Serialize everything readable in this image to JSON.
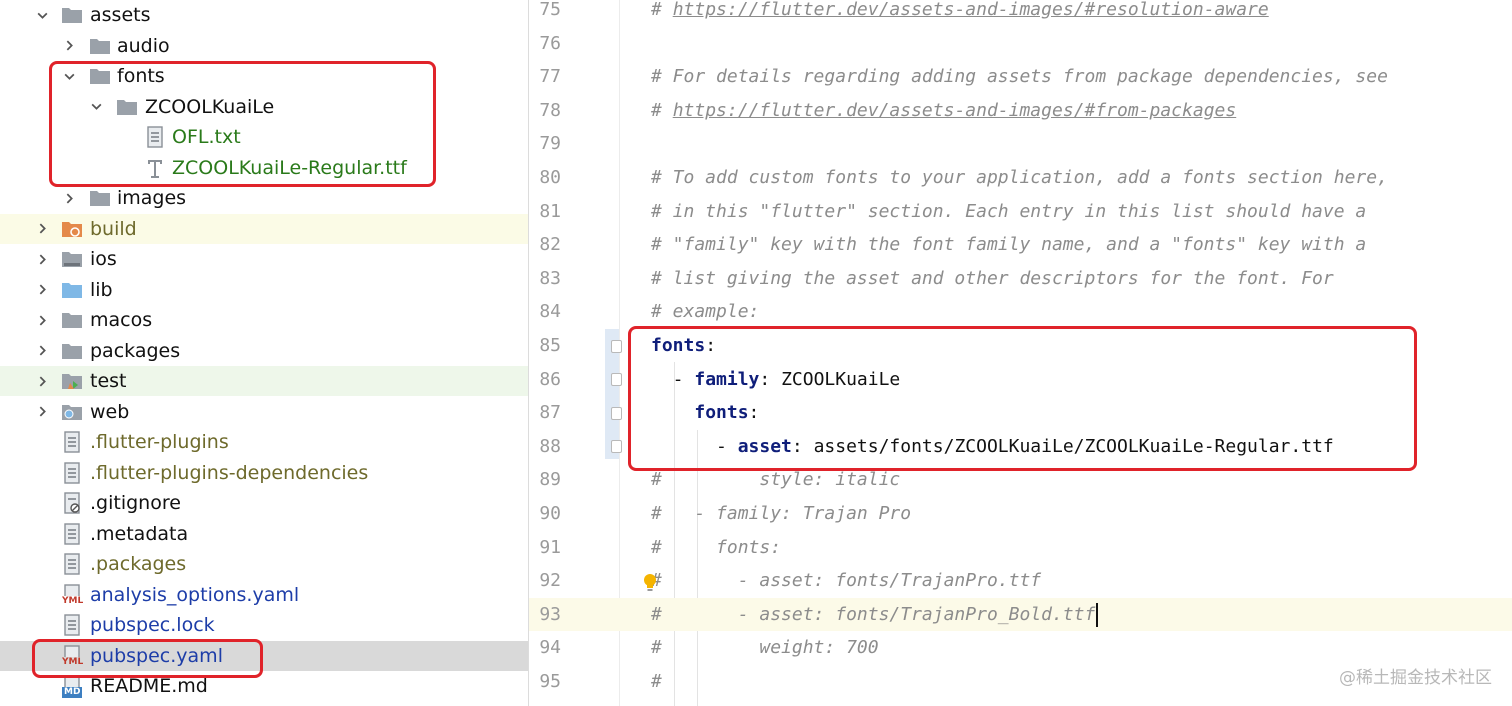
{
  "tree": {
    "rows": [
      {
        "label": "assets",
        "depth": 0,
        "expanded": true,
        "type": "folder"
      },
      {
        "label": "audio",
        "depth": 1,
        "expanded": false,
        "type": "folder"
      },
      {
        "label": "fonts",
        "depth": 1,
        "expanded": true,
        "type": "folder"
      },
      {
        "label": "ZCOOLKuaiLe",
        "depth": 2,
        "expanded": true,
        "type": "folder"
      },
      {
        "label": "OFL.txt",
        "depth": 3,
        "type": "text-file"
      },
      {
        "label": "ZCOOLKuaiLe-Regular.ttf",
        "depth": 3,
        "type": "font-file"
      },
      {
        "label": "images",
        "depth": 1,
        "expanded": false,
        "type": "folder"
      },
      {
        "label": "build",
        "depth": 0,
        "expanded": false,
        "type": "build-folder"
      },
      {
        "label": "ios",
        "depth": 0,
        "expanded": false,
        "type": "folder"
      },
      {
        "label": "lib",
        "depth": 0,
        "expanded": false,
        "type": "source-folder"
      },
      {
        "label": "macos",
        "depth": 0,
        "expanded": false,
        "type": "folder"
      },
      {
        "label": "packages",
        "depth": 0,
        "expanded": false,
        "type": "folder"
      },
      {
        "label": "test",
        "depth": 0,
        "expanded": false,
        "type": "test-folder"
      },
      {
        "label": "web",
        "depth": 0,
        "expanded": false,
        "type": "web-folder"
      },
      {
        "label": ".flutter-plugins",
        "depth": 0,
        "type": "file"
      },
      {
        "label": ".flutter-plugins-dependencies",
        "depth": 0,
        "type": "file"
      },
      {
        "label": ".gitignore",
        "depth": 0,
        "type": "ignore-file"
      },
      {
        "label": ".metadata",
        "depth": 0,
        "type": "file"
      },
      {
        "label": ".packages",
        "depth": 0,
        "type": "file"
      },
      {
        "label": "analysis_options.yaml",
        "depth": 0,
        "type": "yaml-file"
      },
      {
        "label": "pubspec.lock",
        "depth": 0,
        "type": "file"
      },
      {
        "label": "pubspec.yaml",
        "depth": 0,
        "type": "yaml-file",
        "selected": true
      },
      {
        "label": "README.md",
        "depth": 0,
        "type": "md-file"
      }
    ],
    "yaml_badge": "YML",
    "md_badge": "MD"
  },
  "editor": {
    "lines": [
      {
        "num": "75",
        "text": "# https://flutter.dev/assets-and-images/#resolution-aware"
      },
      {
        "num": "76",
        "text": ""
      },
      {
        "num": "77",
        "text": "# For details regarding adding assets from package dependencies, see"
      },
      {
        "num": "78",
        "text": "# https://flutter.dev/assets-and-images/#from-packages"
      },
      {
        "num": "79",
        "text": ""
      },
      {
        "num": "80",
        "text": "# To add custom fonts to your application, add a fonts section here,"
      },
      {
        "num": "81",
        "text": "# in this \"flutter\" section. Each entry in this list should have a"
      },
      {
        "num": "82",
        "text": "# \"family\" key with the font family name, and a \"fonts\" key with a"
      },
      {
        "num": "83",
        "text": "# list giving the asset and other descriptors for the font. For"
      },
      {
        "num": "84",
        "text": "# example:"
      },
      {
        "num": "85",
        "text": "fonts:"
      },
      {
        "num": "86",
        "text": "  - family: ZCOOLKuaiLe"
      },
      {
        "num": "87",
        "text": "    fonts:"
      },
      {
        "num": "88",
        "text": "      - asset: assets/fonts/ZCOOLKuaiLe/ZCOOLKuaiLe-Regular.ttf"
      },
      {
        "num": "89",
        "text": "#         style: italic"
      },
      {
        "num": "90",
        "text": "#   - family: Trajan Pro"
      },
      {
        "num": "91",
        "text": "#     fonts:"
      },
      {
        "num": "92",
        "text": "#       - asset: fonts/TrajanPro.ttf"
      },
      {
        "num": "93",
        "text": "#       - asset: fonts/TrajanPro_Bold.ttf"
      },
      {
        "num": "94",
        "text": "#         weight: 700"
      },
      {
        "num": "95",
        "text": "#"
      }
    ],
    "current_line": "93"
  },
  "watermark": "@稀土掘金技术社区",
  "colors": {
    "highlight_box": "#e0232a",
    "yaml_key": "#0f1e7a",
    "comment": "#8c8c8c",
    "green_file": "#2a7a1a",
    "olive_file": "#6e6a2c",
    "blue_file": "#1d3da8"
  }
}
